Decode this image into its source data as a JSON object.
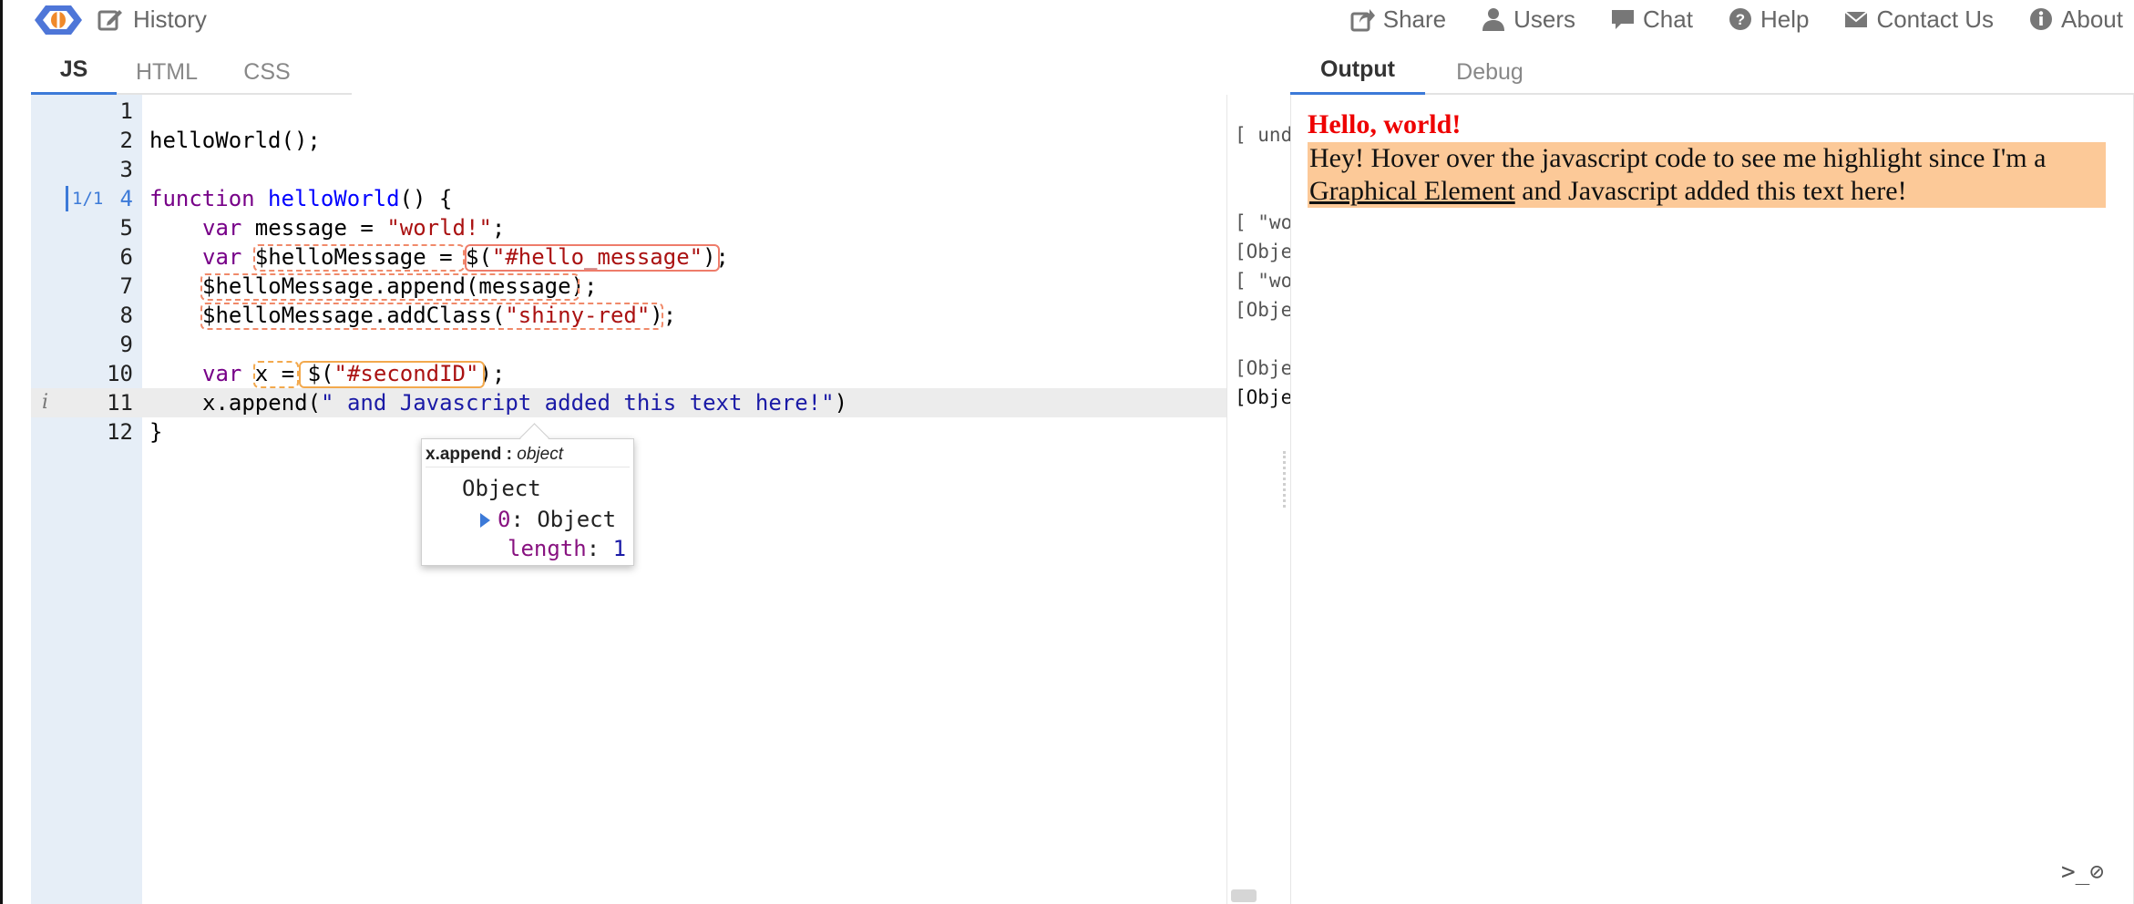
{
  "topbar": {
    "history_label": "History",
    "nav": [
      {
        "label": "Share",
        "icon": "share-icon"
      },
      {
        "label": "Users",
        "icon": "user-icon"
      },
      {
        "label": "Chat",
        "icon": "chat-icon"
      },
      {
        "label": "Help",
        "icon": "help-icon"
      },
      {
        "label": "Contact Us",
        "icon": "mail-icon"
      },
      {
        "label": "About",
        "icon": "info-icon"
      }
    ]
  },
  "editor_tabs": [
    {
      "label": "JS",
      "active": true
    },
    {
      "label": "HTML",
      "active": false
    },
    {
      "label": "CSS",
      "active": false
    }
  ],
  "output_tabs": [
    {
      "label": "Output",
      "active": true
    },
    {
      "label": "Debug",
      "active": false
    }
  ],
  "code": {
    "line_numbers": [
      "1",
      "2",
      "3",
      "4",
      "5",
      "6",
      "7",
      "8",
      "9",
      "10",
      "11",
      "12"
    ],
    "match_badge": "1/1",
    "info_marker": "i",
    "lines": {
      "l2": "helloWorld();",
      "l4_kw": "function",
      "l4_name": "helloWorld",
      "l4_rest": "() {",
      "l5_indent": "    ",
      "l5_kw": "var",
      "l5_mid": " message = ",
      "l5_str": "\"world!\"",
      "l5_end": ";",
      "l6_kw": "var",
      "l6_mid": " $helloMessage = $(",
      "l6_str": "\"#hello_message\"",
      "l6_end": ");",
      "l7": "$helloMessage.append(message);",
      "l8_a": "$helloMessage.addClass(",
      "l8_str": "\"shiny-red\"",
      "l8_end": ");",
      "l10_kw": "var",
      "l10_mid": " x = $(",
      "l10_str": "\"#secondID\"",
      "l10_end": ");",
      "l11_a": "x.append(",
      "l11_str": "\" and Javascript added this text here!\"",
      "l11_end": ")",
      "l12": "}"
    }
  },
  "tooltip": {
    "name": "x.append",
    "sep": " : ",
    "type": "object",
    "root": "Object",
    "key0": "0",
    "val0": ": Object",
    "key_length": "length",
    "val_length_sep": ": ",
    "val_length": "1"
  },
  "values": [
    "[ unde",
    "[ \"wor",
    "[Objec",
    "[ \"wor",
    "[Objec",
    "[Objec",
    "[Objec"
  ],
  "output": {
    "hello": "Hello, world!",
    "second_pre": "Hey! Hover over the javascript code to see me highlight since I'm a ",
    "second_link": "Graphical Element",
    "second_post": " and Javascript added this text here!",
    "console_icon_text": ">_⊘"
  },
  "colors": {
    "accent": "#3c7ad8",
    "gutter": "#e6eef7",
    "highlight_orange": "#fcc998",
    "hello_red": "#ee0000",
    "box_red": "#ee7c6a",
    "box_orange": "#f3a94d"
  }
}
